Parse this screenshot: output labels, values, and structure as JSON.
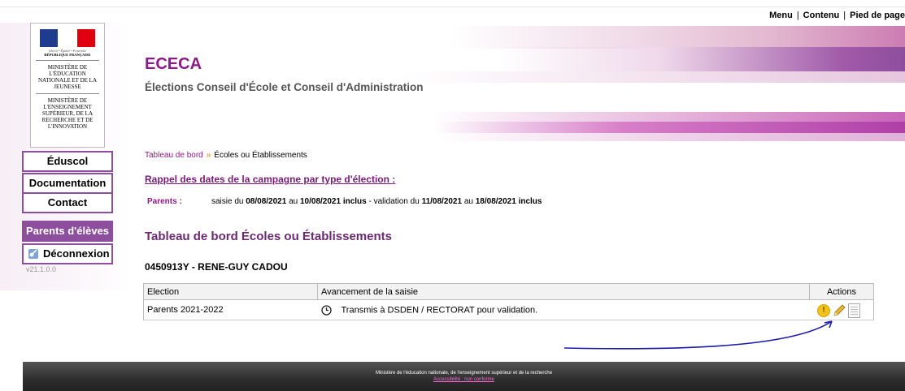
{
  "top_links": {
    "menu": "Menu",
    "contenu": "Contenu",
    "pied": "Pied de page",
    "separator": "|"
  },
  "logo": {
    "motto": "Liberté • Égalité • Fraternité",
    "republic": "RÉPUBLIQUE FRANÇAISE",
    "ministry1": "MINISTÈRE DE L'ÉDUCATION NATIONALE ET DE LA JEUNESSE",
    "ministry2": "MINISTÈRE DE L'ENSEIGNEMENT SUPÉRIEUR, DE LA RECHERCHE ET DE L'INNOVATION"
  },
  "header": {
    "title": "ECECA",
    "subtitle": "Élections Conseil d'École et Conseil d'Administration"
  },
  "nav": {
    "eduscol": "Éduscol",
    "documentation": "Documentation",
    "contact": "Contact",
    "parents": "Parents d'élèves",
    "logout": "Déconnexion",
    "version": "v21.1.0.0"
  },
  "breadcrumb": {
    "home": "Tableau de bord",
    "arrow": "»",
    "current": "Écoles ou Établissements"
  },
  "campaign": {
    "heading": "Rappel des dates de la campagne par type d'élection :",
    "label": "Parents :",
    "t1": "saisie du ",
    "d1": "08/08/2021",
    "t2": " au ",
    "d2": "10/08/2021 inclus",
    "t3": " - validation du ",
    "d3": "11/08/2021",
    "t4": " au ",
    "d4": "18/08/2021 inclus"
  },
  "dashboard": {
    "title": "Tableau de bord Écoles ou Établissements",
    "school": "0450913Y - RENE-GUY CADOU"
  },
  "table": {
    "col_election": "Election",
    "col_progress": "Avancement de la saisie",
    "col_actions": "Actions",
    "row": {
      "election": "Parents 2021-2022",
      "status": "Transmis à DSDEN / RECTORAT pour validation.",
      "warn": "!"
    }
  },
  "footer": {
    "line1": "Ministère de l'éducation nationale, de l'enseignement supérieur et de la recherche",
    "line2": "Accessibilité : non conforme"
  },
  "colors": {
    "brand": "#8b1b87",
    "nav_border": "#8e4e9e",
    "annotation_arrow": "#1a1aa8"
  },
  "icons": {
    "status": "clock-icon",
    "warn": "warning-icon",
    "edit": "pencil-icon",
    "doc": "document-icon",
    "logout": "key-icon"
  }
}
